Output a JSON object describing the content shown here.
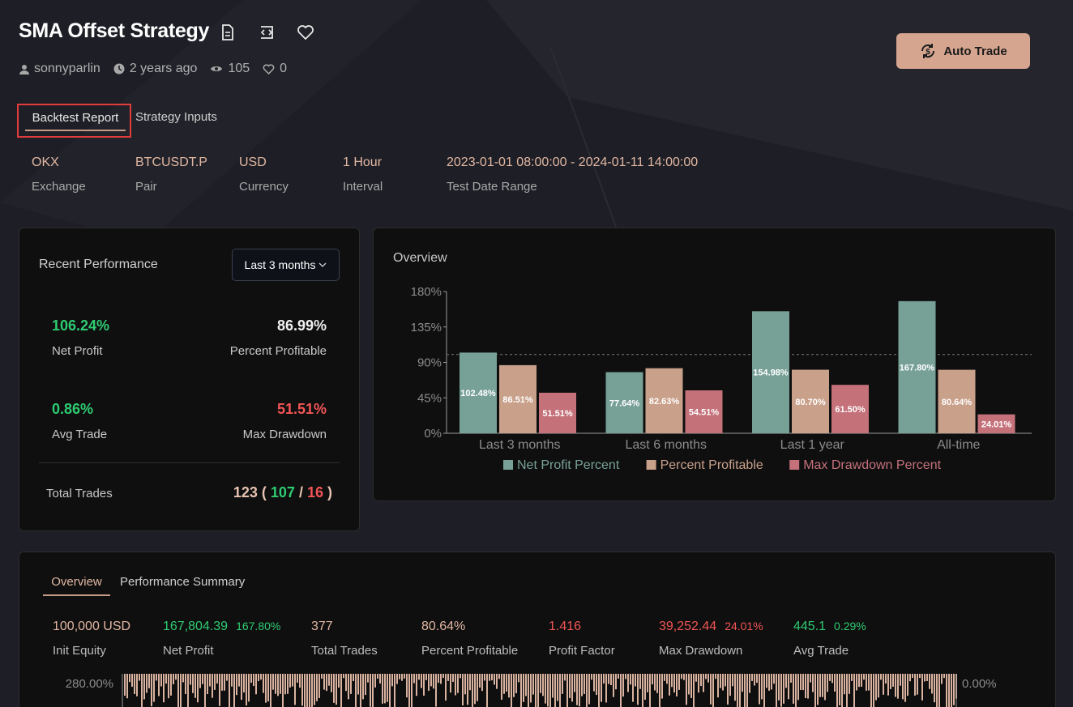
{
  "header": {
    "title": "SMA Offset Strategy",
    "author": "sonnyparlin",
    "age": "2 years ago",
    "views": "105",
    "likes": "0",
    "auto_trade_label": "Auto Trade"
  },
  "tabs": {
    "backtest": "Backtest Report",
    "inputs": "Strategy Inputs"
  },
  "info": [
    {
      "value": "OKX",
      "label": "Exchange"
    },
    {
      "value": "BTCUSDT.P",
      "label": "Pair"
    },
    {
      "value": "USD",
      "label": "Currency"
    },
    {
      "value": "1 Hour",
      "label": "Interval"
    },
    {
      "value": "2023-01-01 08:00:00 - 2024-01-11 14:00:00",
      "label": "Test Date Range"
    }
  ],
  "recent": {
    "title": "Recent Performance",
    "period": "Last 3 months",
    "net_profit": {
      "value": "106.24%",
      "label": "Net Profit"
    },
    "percent_profitable": {
      "value": "86.99%",
      "label": "Percent Profitable"
    },
    "avg_trade": {
      "value": "0.86%",
      "label": "Avg Trade"
    },
    "max_drawdown": {
      "value": "51.51%",
      "label": "Max Drawdown"
    },
    "total_trades_label": "Total Trades",
    "total_trades": "123",
    "wins": "107",
    "losses": "16"
  },
  "overview_chart": {
    "title": "Overview",
    "chart_data": {
      "type": "bar",
      "categories": [
        "Last 3 months",
        "Last 6 months",
        "Last 1 year",
        "All-time"
      ],
      "series": [
        {
          "name": "Net Profit Percent",
          "color": "#77a096",
          "values": [
            102.48,
            77.64,
            154.98,
            167.8
          ]
        },
        {
          "name": "Percent Profitable",
          "color": "#c9a08a",
          "values": [
            86.51,
            82.63,
            80.7,
            80.64
          ]
        },
        {
          "name": "Max Drawdown Percent",
          "color": "#c4717a",
          "values": [
            51.51,
            54.51,
            61.5,
            24.01
          ]
        }
      ],
      "yticks": [
        "0%",
        "45%",
        "90%",
        "135%",
        "180%"
      ],
      "ylim": [
        0,
        180
      ],
      "reference_line": 100,
      "legend_position": "bottom"
    }
  },
  "bottom": {
    "tab_overview": "Overview",
    "tab_summary": "Performance Summary",
    "stats": [
      {
        "value": "100,000 USD",
        "pct": "",
        "label": "Init Equity",
        "color": "peach"
      },
      {
        "value": "167,804.39",
        "pct": "167.80%",
        "label": "Net Profit",
        "color": "green"
      },
      {
        "value": "377",
        "pct": "",
        "label": "Total Trades",
        "color": "peach"
      },
      {
        "value": "80.64%",
        "pct": "",
        "label": "Percent Profitable",
        "color": "peach"
      },
      {
        "value": "1.416",
        "pct": "",
        "label": "Profit Factor",
        "color": "red"
      },
      {
        "value": "39,252.44",
        "pct": "24.01%",
        "label": "Max Drawdown",
        "color": "red"
      },
      {
        "value": "445.1",
        "pct": "0.29%",
        "label": "Avg Trade",
        "color": "green"
      }
    ],
    "equity_left_tick": "280.00%",
    "equity_right_tick": "0.00%"
  }
}
